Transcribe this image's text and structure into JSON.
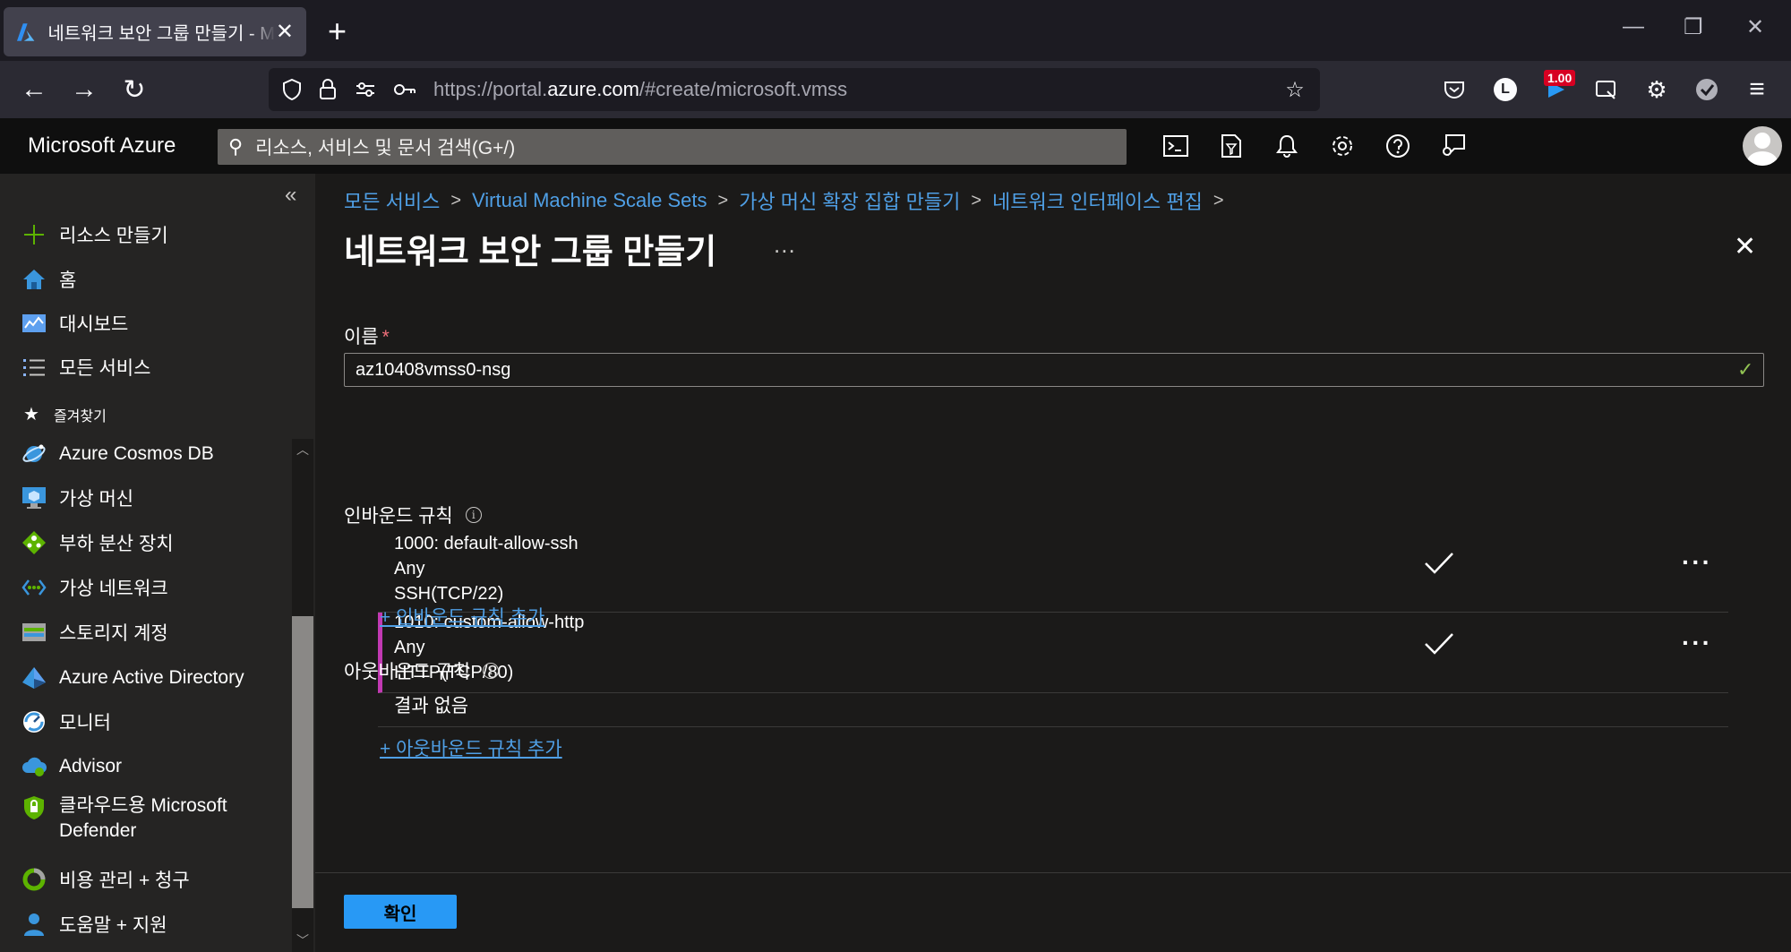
{
  "browser": {
    "tab_title": "네트워크 보안 그룹 만들기 - Microsoft Azure",
    "url_prefix": "https://portal.",
    "url_domain": "azure.com",
    "url_suffix": "/#create/microsoft.vmss",
    "account_badge": "L",
    "extension_badge": "1.00"
  },
  "azure": {
    "brand": "Microsoft Azure",
    "search_placeholder": "리소스, 서비스 및 문서 검색(G+/)"
  },
  "sidebar": {
    "favorites_label": "즐겨찾기",
    "items": [
      {
        "label": "리소스 만들기",
        "icon": "plus-icon"
      },
      {
        "label": "홈",
        "icon": "home-icon"
      },
      {
        "label": "대시보드",
        "icon": "dashboard-icon"
      },
      {
        "label": "모든 서비스",
        "icon": "list-icon"
      },
      {
        "label": "Azure Cosmos DB",
        "icon": "cosmos-db-icon"
      },
      {
        "label": "가상 머신",
        "icon": "virtual-machine-icon"
      },
      {
        "label": "부하 분산 장치",
        "icon": "load-balancer-icon"
      },
      {
        "label": "가상 네트워크",
        "icon": "virtual-network-icon"
      },
      {
        "label": "스토리지 계정",
        "icon": "storage-account-icon"
      },
      {
        "label": "Azure Active Directory",
        "icon": "active-directory-icon"
      },
      {
        "label": "모니터",
        "icon": "monitor-icon"
      },
      {
        "label": "Advisor",
        "icon": "advisor-icon"
      },
      {
        "label": "클라우드용 Microsoft",
        "label2": "Defender",
        "icon": "defender-icon"
      },
      {
        "label": "비용 관리 + 청구",
        "icon": "cost-management-icon"
      },
      {
        "label": "도움말 + 지원",
        "icon": "help-support-icon"
      }
    ]
  },
  "breadcrumb": [
    "모든 서비스",
    "Virtual Machine Scale Sets",
    "가상 머신 확장 집합 만들기",
    "네트워크 인터페이스 편집"
  ],
  "page": {
    "title": "네트워크 보안 그룹 만들기",
    "more": "...",
    "name_label": "이름",
    "required_mark": "*",
    "name_value": "az10408vmss0-nsg",
    "inbound_label": "인바운드 규칙",
    "inbound_rules": [
      {
        "name": "1000: default-allow-ssh",
        "source": "Any",
        "service": "SSH(TCP/22)"
      },
      {
        "name": "1010: custom-allow-http",
        "source": "Any",
        "service": "HTTP(TCP/80)"
      }
    ],
    "add_inbound": "+ 인바운드 규칙 추가",
    "outbound_label": "아웃바운드 규칙",
    "outbound_empty": "결과 없음",
    "add_outbound": "+ 아웃바운드 규칙 추가",
    "ok_label": "확인"
  },
  "colors": {
    "accent": "#2899f5",
    "link": "#4f9fe5",
    "selected_row": "#c239b3",
    "valid": "#92c353"
  }
}
